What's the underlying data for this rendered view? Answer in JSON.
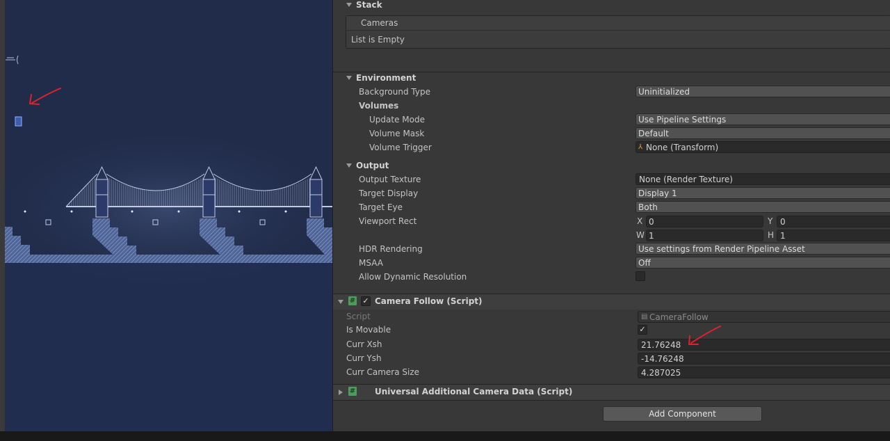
{
  "stack": {
    "title": "Stack",
    "list_header": "Cameras",
    "empty_text": "List is Empty"
  },
  "environment": {
    "title": "Environment",
    "background_type_label": "Background Type",
    "background_type_value": "Uninitialized",
    "volumes_label": "Volumes",
    "update_mode_label": "Update Mode",
    "update_mode_value": "Use Pipeline Settings",
    "volume_mask_label": "Volume Mask",
    "volume_mask_value": "Default",
    "volume_trigger_label": "Volume Trigger",
    "volume_trigger_value": "None (Transform)"
  },
  "output": {
    "title": "Output",
    "output_texture_label": "Output Texture",
    "output_texture_value": "None (Render Texture)",
    "target_display_label": "Target Display",
    "target_display_value": "Display 1",
    "target_eye_label": "Target Eye",
    "target_eye_value": "Both",
    "viewport_rect_label": "Viewport Rect",
    "x_label": "X",
    "x_value": "0",
    "y_label": "Y",
    "y_value": "0",
    "w_label": "W",
    "w_value": "1",
    "h_label": "H",
    "h_value": "1",
    "hdr_label": "HDR Rendering",
    "hdr_value": "Use settings from Render Pipeline Asset",
    "msaa_label": "MSAA",
    "msaa_value": "Off",
    "dynamic_res_label": "Allow Dynamic Resolution",
    "dynamic_res_checked": false
  },
  "camera_follow": {
    "title": "Camera Follow (Script)",
    "enabled_mark": "✓",
    "script_label": "Script",
    "script_value": "CameraFollow",
    "is_movable_label": "Is Movable",
    "is_movable_mark": "✓",
    "curr_xsh_label": "Curr Xsh",
    "curr_xsh_value": "21.76248",
    "curr_ysh_label": "Curr Ysh",
    "curr_ysh_value": "-14.76248",
    "curr_camera_size_label": "Curr Camera Size",
    "curr_camera_size_value": "4.287025"
  },
  "universal_camera_data": {
    "title": "Universal Additional Camera Data (Script)"
  },
  "add_component_label": "Add Component",
  "colors": {
    "scene_bg": "#212c4a",
    "inspector_bg": "#383838",
    "annotation_red": "#d8252a",
    "scene_line": "#9aa7c8"
  }
}
